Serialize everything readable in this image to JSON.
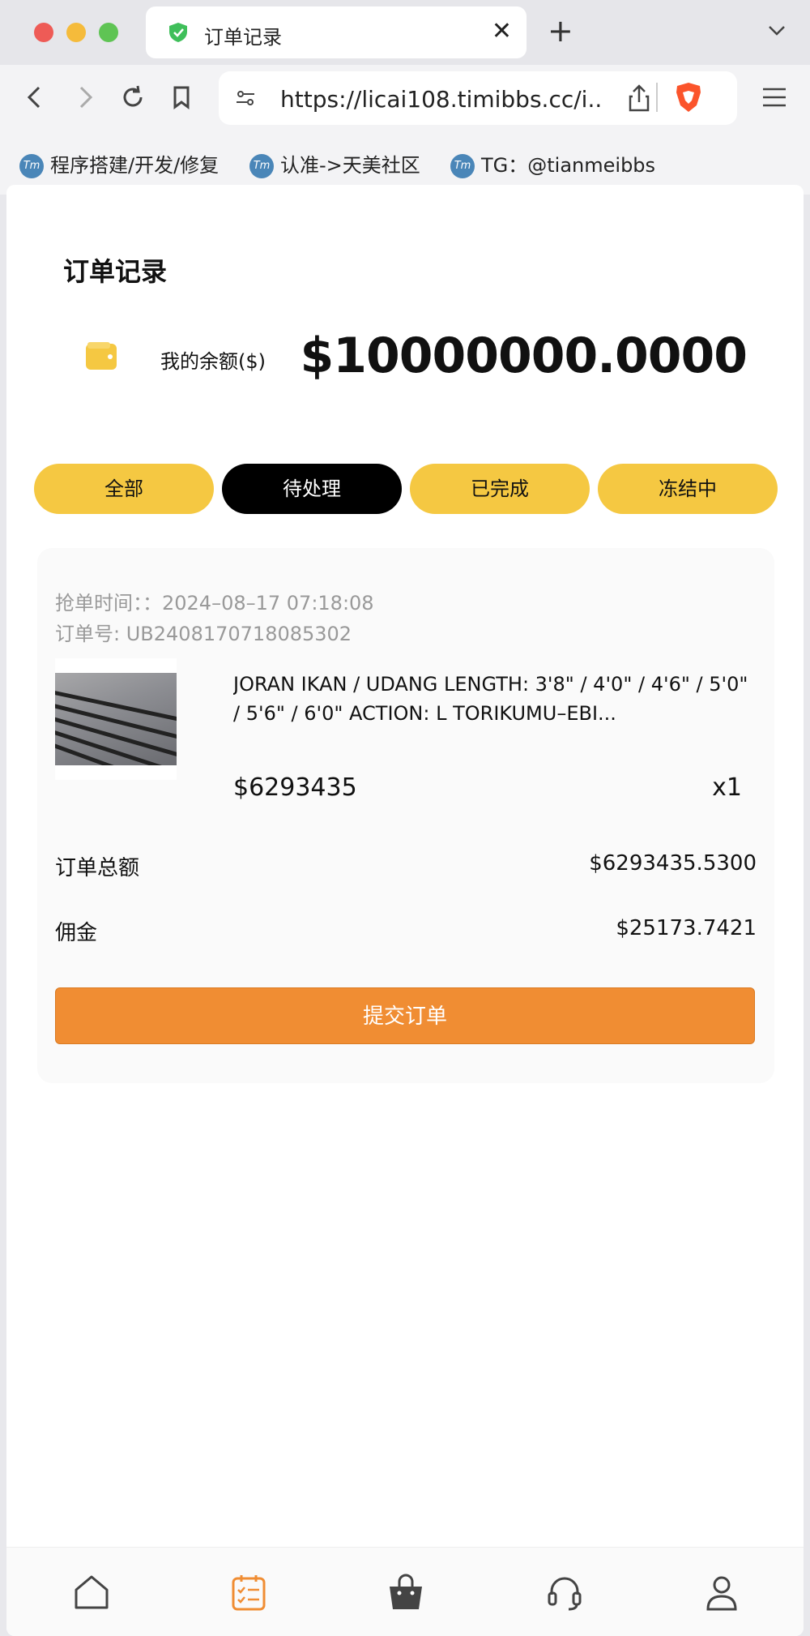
{
  "browser": {
    "tab_title": "订单记录",
    "url": "https://licai108.timibbs.cc/i...",
    "bookmarks": [
      {
        "icon": "tm-icon",
        "label": "程序搭建/开发/修复"
      },
      {
        "icon": "tm-icon",
        "label": "认准->天美社区"
      },
      {
        "icon": "tm-icon",
        "label": "TG：@tianmeibbs"
      }
    ],
    "brave_color": "#fb542b"
  },
  "page": {
    "title": "订单记录",
    "balance_label": "我的余额($)",
    "balance_value": "$10000000.0000",
    "filters": [
      {
        "label": "全部",
        "active": false
      },
      {
        "label": "待处理",
        "active": true
      },
      {
        "label": "已完成",
        "active": false
      },
      {
        "label": "冻结中",
        "active": false
      }
    ],
    "order": {
      "grab_time_label": "抢单时间：",
      "grab_time": "：2024–08–17 07:18:08",
      "order_no_label": "订单号:",
      "order_no": "UB2408170718085302",
      "product_name": "JORAN IKAN / UDANG LENGTH: 3'8\" / 4'0\" / 4'6\" / 5'0\" / 5'6\" / 6'0\" ACTION: L TORIKUMU–EBI...",
      "unit_price": "$6293435",
      "quantity": "x1",
      "total_label": "订单总额",
      "total_value": "$6293435.5300",
      "commission_label": "佣金",
      "commission_value": "$25173.7421",
      "submit_label": "提交订单"
    },
    "bottom_nav": [
      "home-icon",
      "orders-icon",
      "shop-bag-icon",
      "support-headset-icon",
      "profile-icon"
    ],
    "accent_colors": {
      "pill": "#f5c842",
      "submit": "#f08d33",
      "active_nav": "#f08d33"
    }
  }
}
